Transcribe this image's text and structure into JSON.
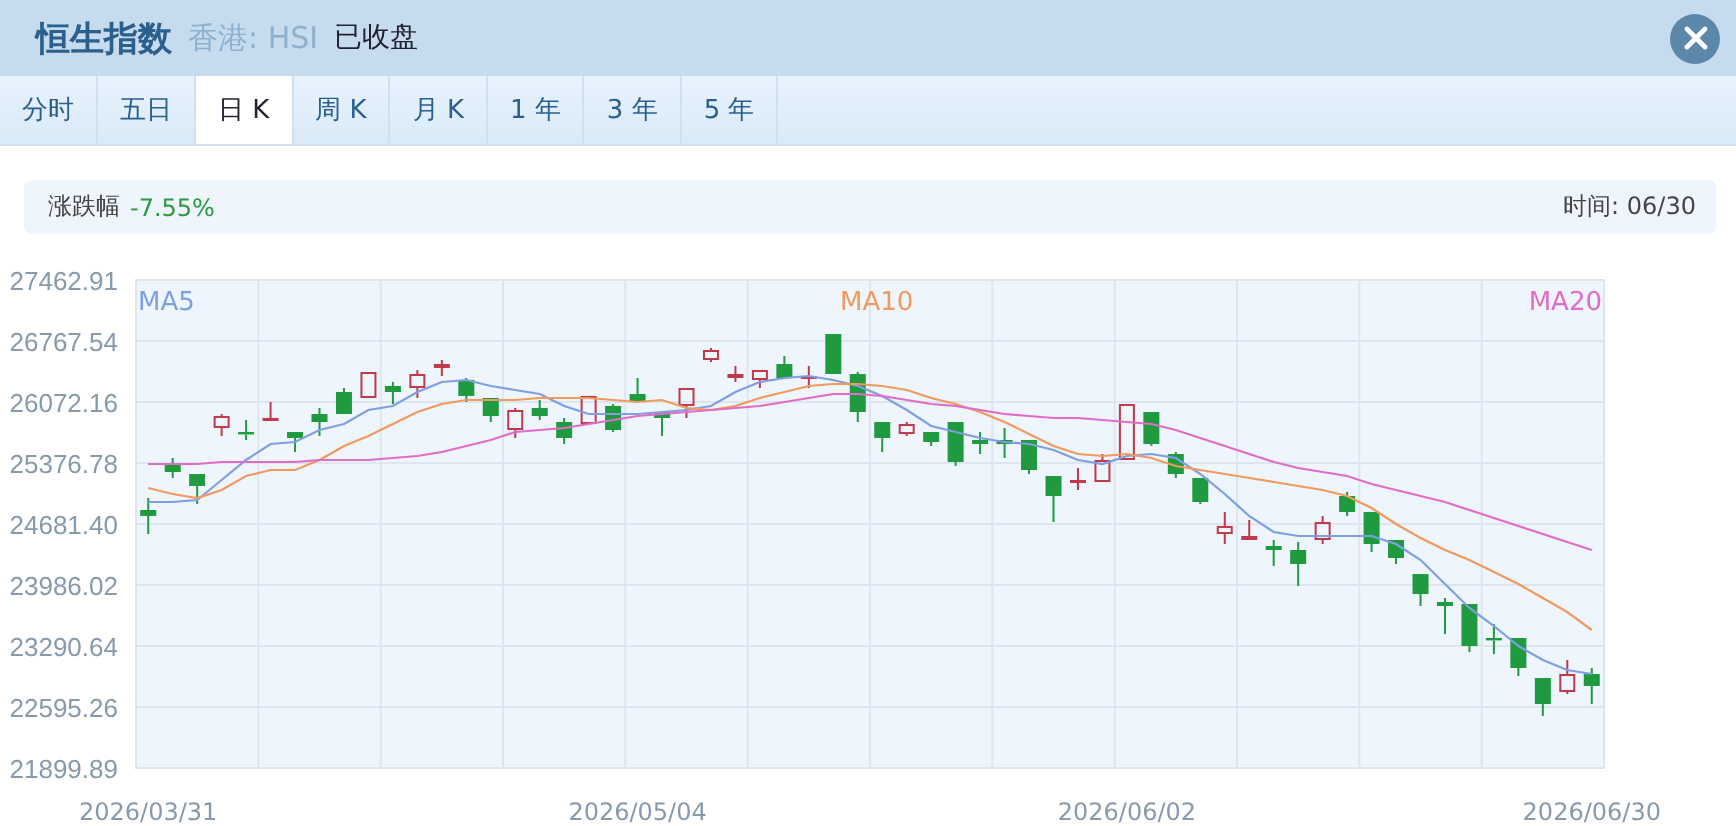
{
  "header": {
    "title": "恒生指数",
    "market": "香港: HSI",
    "status": "已收盘"
  },
  "tabs": [
    {
      "label": "分时",
      "selected": false
    },
    {
      "label": "五日",
      "selected": false
    },
    {
      "label": "日 K",
      "selected": true
    },
    {
      "label": "周 K",
      "selected": false
    },
    {
      "label": "月 K",
      "selected": false
    },
    {
      "label": "1 年",
      "selected": false
    },
    {
      "label": "3 年",
      "selected": false
    },
    {
      "label": "5 年",
      "selected": false
    }
  ],
  "summary": {
    "change_label": "涨跌幅",
    "change_value": "-7.55%",
    "time": "时间: 06/30"
  },
  "chart": {
    "chart_data": {
      "type": "candlestick",
      "ylim": [
        21899.89,
        27462.91
      ],
      "grid": true,
      "categories": [
        "2026/03/31",
        null,
        null,
        null,
        null,
        null,
        null,
        null,
        null,
        null,
        null,
        null,
        null,
        null,
        null,
        null,
        null,
        null,
        null,
        null,
        "2026/05/04",
        null,
        null,
        null,
        null,
        null,
        null,
        null,
        null,
        null,
        null,
        null,
        null,
        null,
        null,
        null,
        null,
        null,
        null,
        null,
        "2026/06/02",
        null,
        null,
        null,
        null,
        null,
        null,
        null,
        null,
        null,
        null,
        null,
        null,
        null,
        null,
        null,
        null,
        null,
        null,
        "2026/06/30"
      ],
      "yticks": [
        {
          "value": 27462.91,
          "label": "27462.91"
        },
        {
          "value": 26767.54,
          "label": "26767.54"
        },
        {
          "value": 26072.16,
          "label": "26072.16"
        },
        {
          "value": 25376.78,
          "label": "25376.78"
        },
        {
          "value": 24681.4,
          "label": "24681.40"
        },
        {
          "value": 23986.02,
          "label": "23986.02"
        },
        {
          "value": 23290.64,
          "label": "23290.64"
        },
        {
          "value": 22595.26,
          "label": "22595.26"
        },
        {
          "value": 21899.89,
          "label": "21899.89"
        }
      ],
      "ohlc": [
        [
          24841,
          24978,
          24567,
          24773
        ],
        [
          25365,
          25434,
          25206,
          25274
        ],
        [
          25251,
          25251,
          24909,
          25115
        ],
        [
          25776,
          25935,
          25685,
          25913
        ],
        [
          25730,
          25867,
          25639,
          25707
        ],
        [
          25867,
          26072,
          25867,
          25890
        ],
        [
          25730,
          25730,
          25502,
          25662
        ],
        [
          25935,
          26004,
          25685,
          25844
        ],
        [
          26186,
          26232,
          25935,
          25935
        ],
        [
          26118,
          26414,
          26118,
          26414
        ],
        [
          26255,
          26300,
          26049,
          26186
        ],
        [
          26232,
          26437,
          26118,
          26391
        ],
        [
          26460,
          26551,
          26369,
          26505
        ],
        [
          26323,
          26346,
          26072,
          26141
        ],
        [
          26118,
          26118,
          25844,
          25913
        ],
        [
          25753,
          26004,
          25662,
          25981
        ],
        [
          26004,
          26095,
          25867,
          25913
        ],
        [
          25844,
          25890,
          25593,
          25662
        ],
        [
          25821,
          26141,
          25821,
          26141
        ],
        [
          26027,
          26049,
          25730,
          25753
        ],
        [
          26163,
          26346,
          26072,
          26072
        ],
        [
          25958,
          25958,
          25685,
          25890
        ],
        [
          26027,
          26232,
          25890,
          26232
        ],
        [
          26551,
          26688,
          26528,
          26665
        ],
        [
          26346,
          26483,
          26300,
          26391
        ],
        [
          26323,
          26437,
          26232,
          26437
        ],
        [
          26505,
          26597,
          26346,
          26346
        ],
        [
          26346,
          26483,
          26232,
          26369
        ],
        [
          26847,
          26847,
          26391,
          26391
        ],
        [
          26391,
          26414,
          25844,
          25958
        ],
        [
          25844,
          25844,
          25502,
          25662
        ],
        [
          25707,
          25844,
          25685,
          25821
        ],
        [
          25730,
          25730,
          25571,
          25616
        ],
        [
          25844,
          25844,
          25343,
          25388
        ],
        [
          25639,
          25730,
          25479,
          25593
        ],
        [
          25639,
          25776,
          25434,
          25593
        ],
        [
          25639,
          25639,
          25251,
          25297
        ],
        [
          25229,
          25229,
          24704,
          25001
        ],
        [
          25160,
          25320,
          25069,
          25183
        ],
        [
          25160,
          25479,
          25160,
          25411
        ],
        [
          25411,
          26049,
          25411,
          26049
        ],
        [
          25958,
          25958,
          25571,
          25593
        ],
        [
          25479,
          25502,
          25206,
          25251
        ],
        [
          25206,
          25206,
          24909,
          24932
        ],
        [
          24567,
          24818,
          24453,
          24659
        ],
        [
          24499,
          24727,
          24499,
          24545
        ],
        [
          24431,
          24499,
          24203,
          24385
        ],
        [
          24385,
          24476,
          23975,
          24225
        ],
        [
          24499,
          24773,
          24453,
          24704
        ],
        [
          25001,
          25046,
          24773,
          24818
        ],
        [
          24818,
          24818,
          24362,
          24453
        ],
        [
          24499,
          24499,
          24225,
          24294
        ],
        [
          24111,
          24111,
          23747,
          23883
        ],
        [
          23792,
          23838,
          23427,
          23747
        ],
        [
          23769,
          23769,
          23222,
          23291
        ],
        [
          23382,
          23541,
          23199,
          23359
        ],
        [
          23382,
          23382,
          22949,
          23040
        ],
        [
          22926,
          22926,
          22493,
          22629
        ],
        [
          22766,
          23131,
          22743,
          22971
        ],
        [
          22971,
          23040,
          22629,
          22835
        ]
      ],
      "series": [
        {
          "type": "line",
          "name": "MA5",
          "color": "#7f9fe0",
          "values": [
            24932,
            24932,
            24955,
            25183,
            25411,
            25593,
            25616,
            25753,
            25821,
            25981,
            26027,
            26186,
            26300,
            26323,
            26255,
            26209,
            26163,
            26027,
            25935,
            25935,
            25935,
            25958,
            25981,
            26027,
            26186,
            26300,
            26346,
            26369,
            26323,
            26255,
            26141,
            25981,
            25799,
            25730,
            25662,
            25616,
            25593,
            25525,
            25411,
            25365,
            25457,
            25479,
            25434,
            25251,
            25023,
            24773,
            24590,
            24545,
            24545,
            24545,
            24545,
            24453,
            24271,
            23997,
            23724,
            23519,
            23291,
            23131,
            23017,
            22971
          ]
        },
        {
          "type": "line",
          "name": "MA10",
          "color": "#f09a5e",
          "values": [
            25092,
            25023,
            24978,
            25069,
            25229,
            25297,
            25297,
            25411,
            25571,
            25685,
            25821,
            25958,
            26049,
            26095,
            26095,
            26095,
            26118,
            26118,
            26118,
            26095,
            26072,
            26095,
            26004,
            25981,
            26027,
            26118,
            26186,
            26255,
            26277,
            26277,
            26255,
            26209,
            26118,
            26049,
            25958,
            25844,
            25707,
            25571,
            25479,
            25457,
            25479,
            25434,
            25343,
            25297,
            25251,
            25206,
            25160,
            25115,
            25069,
            25001,
            24864,
            24681,
            24522,
            24385,
            24271,
            24134,
            23997,
            23838,
            23678,
            23473
          ]
        },
        {
          "type": "line",
          "name": "MA20",
          "color": "#e06cc8",
          "values": [
            25365,
            25365,
            25365,
            25388,
            25388,
            25388,
            25388,
            25411,
            25411,
            25411,
            25434,
            25457,
            25502,
            25571,
            25639,
            25730,
            25753,
            25776,
            25821,
            25867,
            25913,
            25935,
            25958,
            25981,
            26004,
            26027,
            26072,
            26118,
            26163,
            26163,
            26141,
            26095,
            26049,
            26027,
            25981,
            25935,
            25913,
            25890,
            25890,
            25867,
            25844,
            25821,
            25753,
            25662,
            25571,
            25479,
            25388,
            25320,
            25274,
            25229,
            25137,
            25069,
            25001,
            24932,
            24841,
            24750,
            24659,
            24567,
            24476,
            24385
          ]
        }
      ]
    }
  }
}
